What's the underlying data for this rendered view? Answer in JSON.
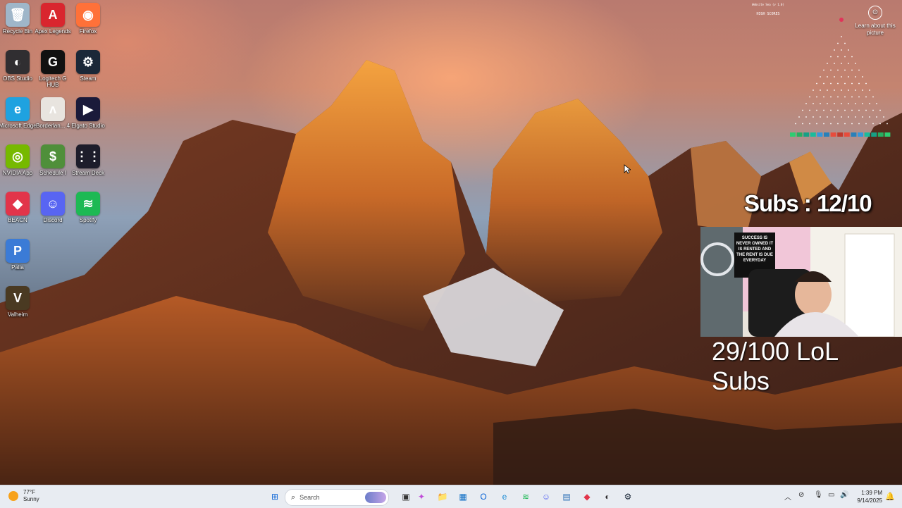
{
  "desktop": {
    "icons": [
      {
        "label": "Recycle Bin",
        "icon": "recycle-bin-icon",
        "color": "#9fb6c9",
        "glyph": "🗑"
      },
      {
        "label": "Apex Legends",
        "icon": "apex-legends-icon",
        "color": "#d9262e",
        "glyph": "A"
      },
      {
        "label": "Firefox",
        "icon": "firefox-icon",
        "color": "#ff7139",
        "glyph": "◉"
      },
      {
        "label": "OBS Studio",
        "icon": "obs-studio-icon",
        "color": "#302e31",
        "glyph": "◐"
      },
      {
        "label": "Logitech G HUB",
        "icon": "logitech-ghub-icon",
        "color": "#111111",
        "glyph": "G"
      },
      {
        "label": "Steam",
        "icon": "steam-icon",
        "color": "#1b2838",
        "glyph": "⚙"
      },
      {
        "label": "Microsoft Edge",
        "icon": "edge-icon",
        "color": "#1fa2e0",
        "glyph": "e"
      },
      {
        "label": "Borderlan... 4",
        "icon": "borderlands-icon",
        "color": "#e8e4df",
        "glyph": "ʌ"
      },
      {
        "label": "Elgato Studio",
        "icon": "elgato-studio-icon",
        "color": "#1a1a3a",
        "glyph": "▶"
      },
      {
        "label": "NVIDIA App",
        "icon": "nvidia-icon",
        "color": "#76b900",
        "glyph": "◎"
      },
      {
        "label": "Schedule I",
        "icon": "schedule-i-icon",
        "color": "#4f8f3a",
        "glyph": "$"
      },
      {
        "label": "Stream Deck",
        "icon": "stream-deck-icon",
        "color": "#1d1d2b",
        "glyph": "⋮⋮"
      },
      {
        "label": "BEACN",
        "icon": "beacn-icon",
        "color": "#e2344a",
        "glyph": "◆"
      },
      {
        "label": "Discord",
        "icon": "discord-icon",
        "color": "#5865f2",
        "glyph": "☺"
      },
      {
        "label": "Spotify",
        "icon": "spotify-icon",
        "color": "#1db954",
        "glyph": "≋"
      },
      {
        "label": "Palia",
        "icon": "palia-icon",
        "color": "#3b7bd6",
        "glyph": "P"
      },
      {
        "label": "Valheim",
        "icon": "valheim-icon",
        "color": "#4a3a22",
        "glyph": "V"
      }
    ]
  },
  "overlay": {
    "learn_label": "Learn about this picture",
    "scoreboard_title": "Website Sea (v 1.0)",
    "high_scores_label": "HIGH SCORES",
    "sub_goal": "Subs : 12/10",
    "lol_subs": "29/100 LoL Subs",
    "webcam_poster": "SUCCESS IS NEVER OWNED IT IS RENTED AND THE RENT IS DUE EVERYDAY"
  },
  "taskbar": {
    "weather": {
      "temp": "77°F",
      "condition": "Sunny"
    },
    "search_placeholder": "Search",
    "apps": [
      {
        "name": "windows-start-icon",
        "glyph": "⊞",
        "color": "#0a64d6"
      },
      {
        "name": "task-view-icon",
        "glyph": "▣",
        "color": "#333333"
      },
      {
        "name": "copilot-icon",
        "glyph": "✦",
        "color": "#c04bd8"
      },
      {
        "name": "file-explorer-icon",
        "glyph": "📁",
        "color": "#f4b400"
      },
      {
        "name": "microsoft-store-icon",
        "glyph": "▦",
        "color": "#0b6cc4"
      },
      {
        "name": "outlook-icon",
        "glyph": "O",
        "color": "#0a64d6"
      },
      {
        "name": "edge-taskbar-icon",
        "glyph": "e",
        "color": "#1a8ad4"
      },
      {
        "name": "spotify-taskbar-icon",
        "glyph": "≋",
        "color": "#1db954"
      },
      {
        "name": "discord-taskbar-icon",
        "glyph": "☺",
        "color": "#5865f2"
      },
      {
        "name": "photos-taskbar-icon",
        "glyph": "▤",
        "color": "#2b6fb6"
      },
      {
        "name": "beacn-taskbar-icon",
        "glyph": "◆",
        "color": "#e2344a"
      },
      {
        "name": "obs-taskbar-icon",
        "glyph": "◐",
        "color": "#302e31"
      },
      {
        "name": "steam-taskbar-icon",
        "glyph": "⚙",
        "color": "#1b2838"
      }
    ],
    "clock": {
      "time": "1:39 PM",
      "date": "9/14/2025"
    }
  }
}
